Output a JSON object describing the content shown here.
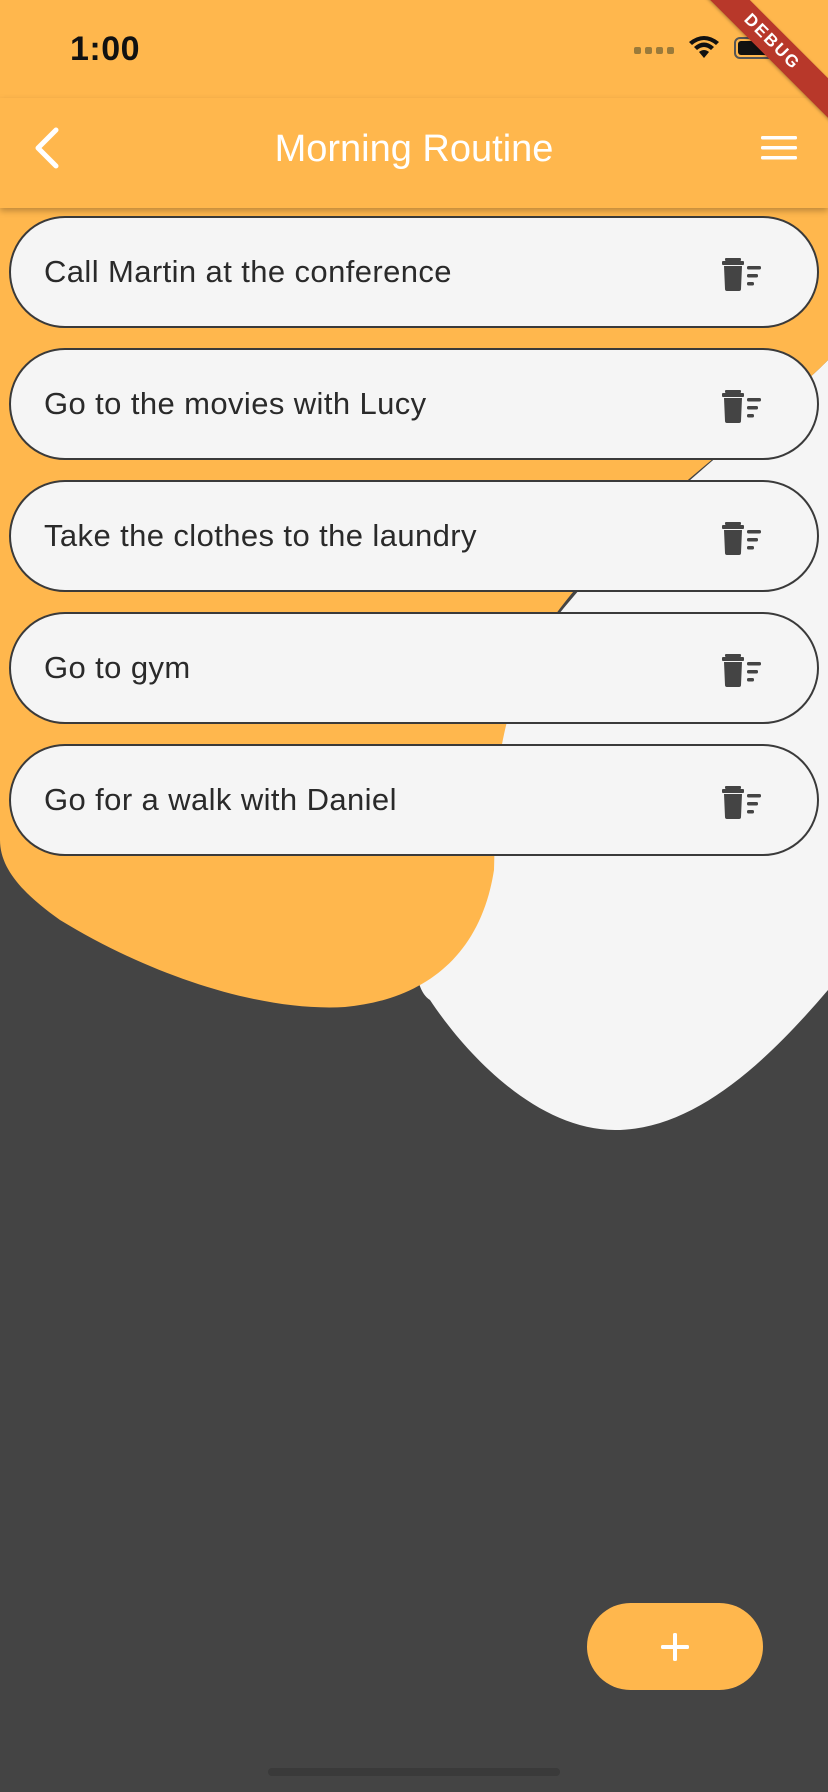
{
  "status_bar": {
    "time": "1:00",
    "debug_label": "DEBUG"
  },
  "app_bar": {
    "title": "Morning Routine",
    "back_icon": "chevron-left-icon",
    "menu_icon": "hamburger-menu-icon"
  },
  "tasks": [
    {
      "label": "Call Martin at the conference"
    },
    {
      "label": "Go to the movies with Lucy"
    },
    {
      "label": "Take the clothes to the laundry"
    },
    {
      "label": "Go to gym"
    },
    {
      "label": "Go for a walk with Daniel"
    }
  ],
  "task_action_icon": "delete-sweep-icon",
  "fab": {
    "icon": "plus-icon"
  },
  "colors": {
    "accent": "#ffb74d",
    "background_dark": "#444444",
    "background_light": "#f5f5f5",
    "text_dark": "#2a2a2a",
    "text_light": "#ffffff",
    "debug_ribbon": "#b8382a"
  }
}
